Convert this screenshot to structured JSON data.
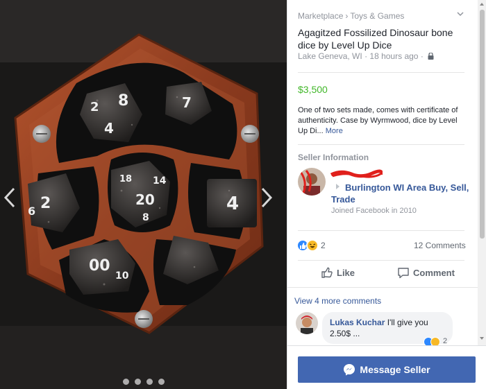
{
  "breadcrumb": {
    "root": "Marketplace",
    "separator": "›",
    "category": "Toys & Games"
  },
  "listing": {
    "title": "Agagitzed Fossilized Dinosaur bone dice by Level Up Dice",
    "location": "Lake Geneva, WI",
    "dot": "·",
    "time": "18 hours ago",
    "price": "$3,500",
    "description": "One of two sets made, comes with certificate of authenticity. Case by Wyrmwood, dice by Level Up Di...",
    "more_link": "More"
  },
  "seller": {
    "heading": "Seller Information",
    "group": "Burlington WI Area Buy, Sell, Trade",
    "joined": "Joined Facebook in 2010"
  },
  "engagement": {
    "reaction_count": "2",
    "comments_count": "12 Comments",
    "like_label": "Like",
    "comment_label": "Comment",
    "view_more": "View 4 more comments"
  },
  "comment": {
    "author": "Lukas Kuchar",
    "text": "I'll give you 2.50$ ...",
    "reaction_count": "2"
  },
  "footer": {
    "message_button": "Message Seller"
  },
  "photo": {
    "dice_labels": [
      "8",
      "2",
      "4",
      "7",
      "18",
      "14",
      "20",
      "6",
      "2",
      "8",
      "4",
      "00",
      "10"
    ],
    "carousel_dots": 4
  },
  "colors": {
    "link": "#365899",
    "price": "#42b72a",
    "button": "#4267b2",
    "muted": "#90949c",
    "wood": "#8a3a1e",
    "redaction": "#e0201c"
  },
  "icons": {
    "chevron": "chevron-down-icon",
    "privacy": "lock-icon",
    "like": "thumbs-up-icon",
    "comment": "comment-bubble-icon",
    "messenger": "messenger-icon"
  }
}
